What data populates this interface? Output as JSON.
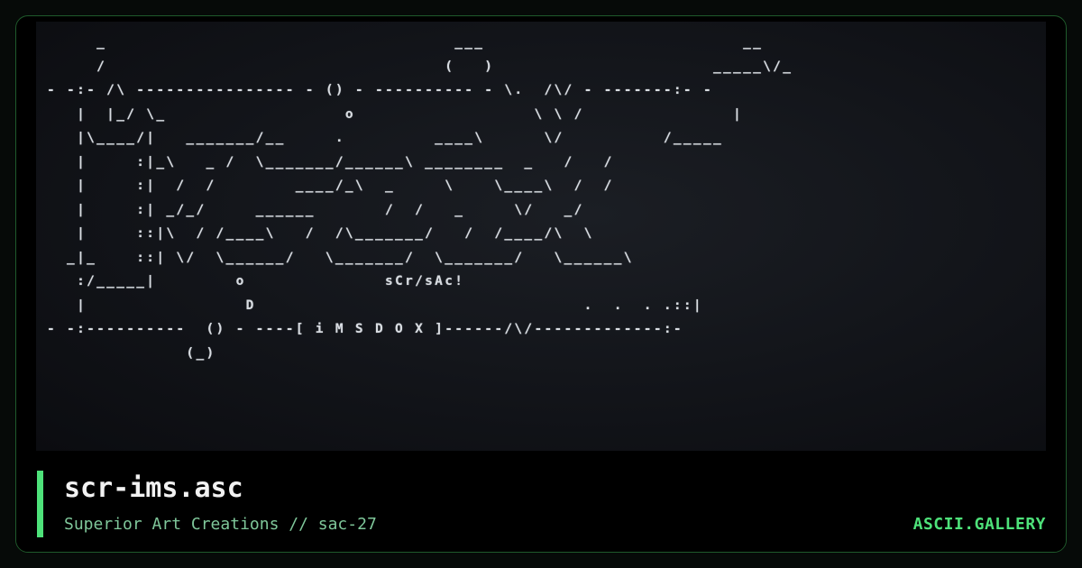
{
  "art": {
    "text": "     _                                   ___                          __\n     /                                  (   )                      _____\\/_\n- -:- /\\ ---------------- - () - ---------- - \\.  /\\/ - -------:- -\n   |  |_/ \\_                  o                  \\ \\ /               |\n   |\\____/|   _______/__     .         ____\\      \\/          /_____\n   |     :|_\\   _ /  \\_______/______\\ ________  _   /   /\n   |     :|  /  /        ____/_\\  _     \\    \\____\\  /  /\n   |     :| _/_/     ______       /  /   _     \\/   _/\n   |     ::|\\  / /____\\   /  /\\_______/   /  /____/\\  \\\n  _|_    ::| \\/  \\______/   \\_______/  \\_______/   \\______\\\n   :/_____|        o              sCr/sAc!\n   |                D                                 .  .  . .::|\n- -:----------  () - ----[ i M S D O X ]------/\\/-------------:-\n              (_)"
  },
  "footer": {
    "title": "scr-ims.asc",
    "subtitle": "Superior Art Creations // sac-27",
    "brand": "ASCII.GALLERY"
  },
  "colors": {
    "accent": "#4ee27a",
    "subtitle": "#7fc79a",
    "border": "#1f5a2b",
    "background": "#000000"
  }
}
